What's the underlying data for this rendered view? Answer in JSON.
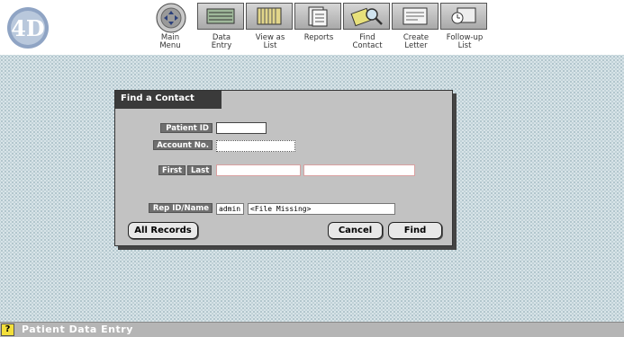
{
  "toolbar": {
    "logo_text": "4D",
    "buttons": [
      {
        "label": "Main\nMenu"
      },
      {
        "label": "Data\nEntry"
      },
      {
        "label": "View as\nList"
      },
      {
        "label": "Reports"
      },
      {
        "label": "Find\nContact"
      },
      {
        "label": "Create\nLetter"
      },
      {
        "label": "Follow-up\nList"
      }
    ]
  },
  "dialog": {
    "title": "Find a Contact",
    "labels": {
      "patient_id": "Patient ID",
      "account_no": "Account No.",
      "first": "First",
      "last": "Last",
      "rep": "Rep ID/Name"
    },
    "fields": {
      "patient_id": "",
      "account_no": "",
      "first": "",
      "last": "",
      "rep_id": "admin",
      "rep_name": "<File Missing>"
    },
    "buttons": {
      "all_records": "All Records",
      "cancel": "Cancel",
      "find": "Find"
    }
  },
  "status": {
    "icon": "?",
    "text": "Patient Data Entry"
  }
}
